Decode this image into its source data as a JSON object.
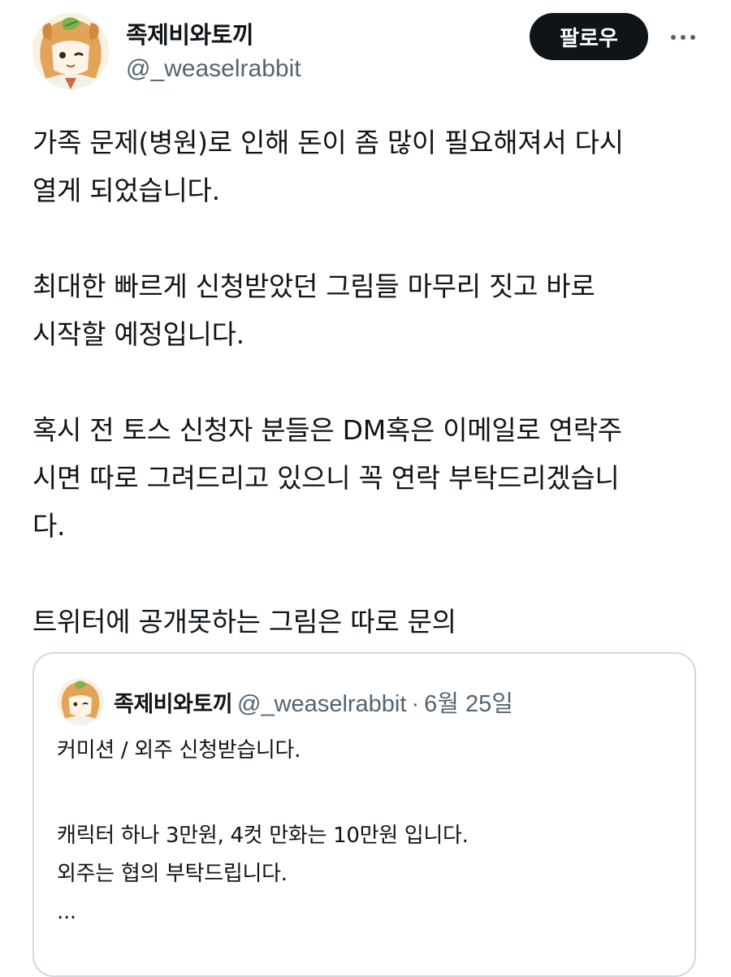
{
  "author": {
    "display_name": "족제비와토끼",
    "handle": "@_weaselrabbit"
  },
  "actions": {
    "follow_label": "팔로우",
    "more_icon": "more-horizontal-icon"
  },
  "tweet": {
    "paragraphs": [
      [
        "가족 문제(병원)로 인해 돈이 좀 많이 필요해져서 다시",
        "열게 되었습니다."
      ],
      [
        "최대한 빠르게 신청받았던 그림들 마무리 짓고 바로",
        "시작할 예정입니다."
      ],
      [
        "혹시 전 토스 신청자 분들은 DM혹은 이메일로 연락주",
        "시면 따로 그려드리고 있으니 꼭 연락 부탁드리겠습니",
        "다."
      ],
      [
        "트위터에 공개못하는 그림은 따로 문의"
      ]
    ]
  },
  "quoted_tweet": {
    "display_name": "족제비와토끼",
    "handle": "@_weaselrabbit",
    "separator": "·",
    "date": "6월 25일",
    "paragraphs": [
      [
        "커미션 / 외주 신청받습니다."
      ],
      [
        "캐릭터 하나 3만원, 4컷 만화는 10만원 입니다.",
        "외주는 협의 부탁드립니다.",
        "..."
      ]
    ]
  },
  "colors": {
    "text": "#0f1419",
    "secondary": "#536471",
    "follow_bg": "#0f1419",
    "border": "#cfd9de"
  }
}
